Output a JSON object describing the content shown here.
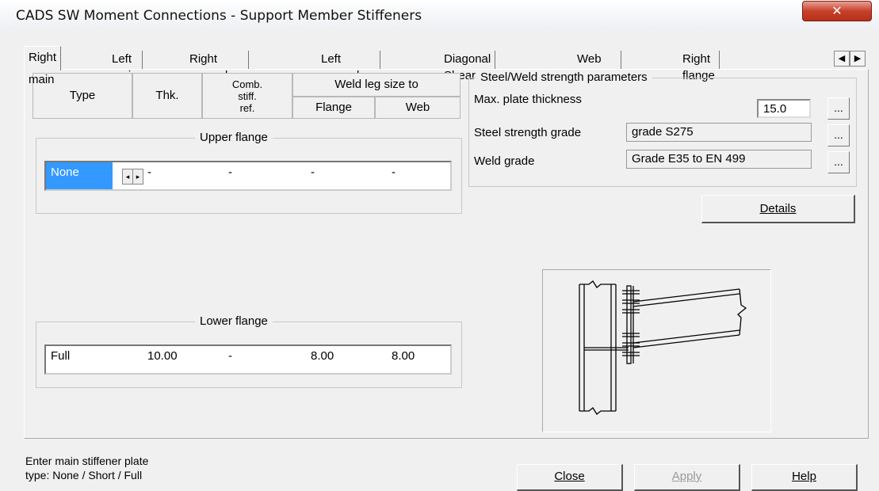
{
  "window": {
    "title": "CADS SW Moment Connections - Support Member Stiffeners",
    "close_glyph": "✕"
  },
  "tabs": [
    "Right main",
    "Left main",
    "Right secondary",
    "Left secondary",
    "Diagonal Shear",
    "Web doubler",
    "Right flange"
  ],
  "tab_scroll": {
    "left": "◀",
    "right": "▶"
  },
  "columns": {
    "type": "Type",
    "thk": "Thk.",
    "comb_l1": "Comb.",
    "comb_l2": "stiff.",
    "comb_l3": "ref.",
    "weld_leg": "Weld leg size to",
    "flange": "Flange",
    "web": "Web"
  },
  "upper_flange": {
    "legend": "Upper flange",
    "type": "None",
    "spin_left": "◂",
    "spin_right": "▸",
    "thk": "-",
    "comb": "-",
    "flange": "-",
    "web": "-"
  },
  "lower_flange": {
    "legend": "Lower flange",
    "type": "Full",
    "thk": "10.00",
    "comb": "-",
    "flange": "8.00",
    "web": "8.00"
  },
  "params": {
    "legend": "Steel/Weld strength parameters",
    "max_plate_label": "Max. plate thickness",
    "max_plate_value": "15.0",
    "steel_grade_label": "Steel strength grade",
    "steel_grade_value": "grade S275",
    "weld_grade_label": "Weld grade",
    "weld_grade_value": "Grade E35 to EN 499",
    "ellipsis": "..."
  },
  "buttons": {
    "details": "Details",
    "close": "Close",
    "apply": "Apply",
    "help": "Help"
  },
  "status": {
    "line1": "Enter main stiffener plate",
    "line2": "type: None / Short / Full"
  }
}
